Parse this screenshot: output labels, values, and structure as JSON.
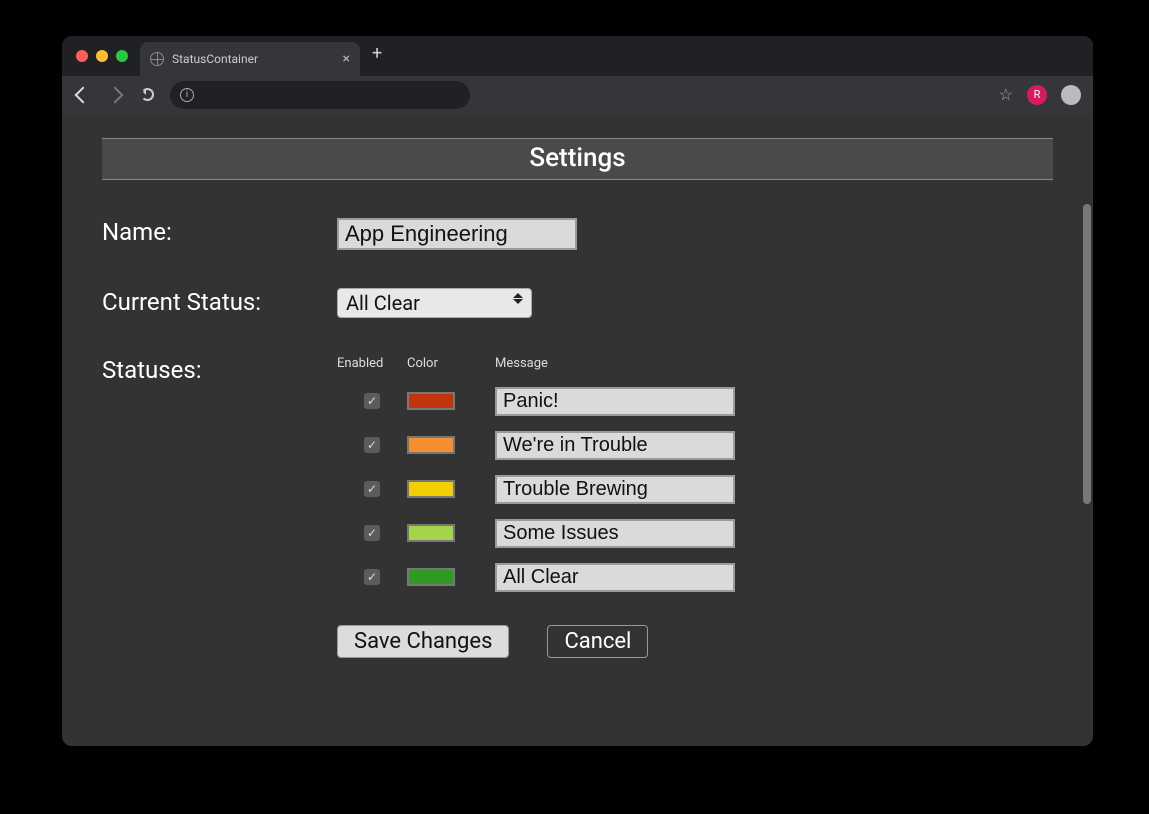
{
  "browser": {
    "tab_title": "StatusContainer",
    "url_text": "",
    "avatar_letter": "R"
  },
  "page": {
    "title": "Settings",
    "labels": {
      "name": "Name:",
      "current_status": "Current Status:",
      "statuses": "Statuses:"
    },
    "name_value": "App Engineering",
    "current_status_value": "All Clear",
    "columns": {
      "enabled": "Enabled",
      "color": "Color",
      "message": "Message"
    },
    "statuses": [
      {
        "enabled": true,
        "color": "#c0350b",
        "message": "Panic!"
      },
      {
        "enabled": true,
        "color": "#f58e30",
        "message": "We're in Trouble"
      },
      {
        "enabled": true,
        "color": "#f3cf00",
        "message": "Trouble Brewing"
      },
      {
        "enabled": true,
        "color": "#a5d34a",
        "message": "Some Issues"
      },
      {
        "enabled": true,
        "color": "#2e9a23",
        "message": "All Clear"
      }
    ],
    "buttons": {
      "save": "Save Changes",
      "cancel": "Cancel"
    }
  }
}
